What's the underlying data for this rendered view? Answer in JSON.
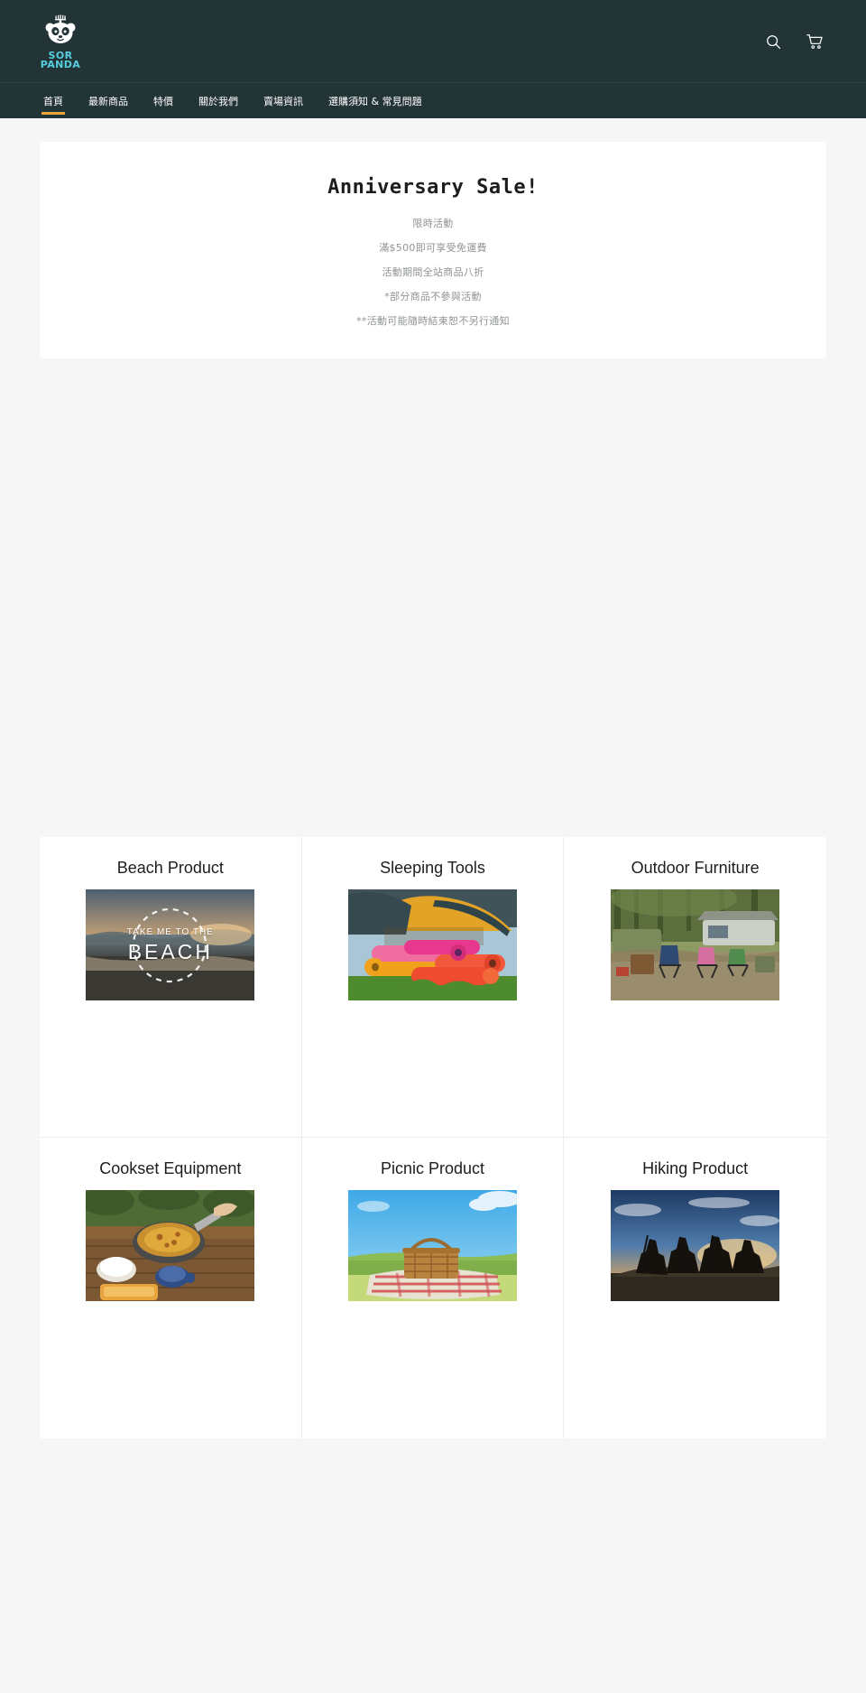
{
  "header": {
    "logo": {
      "line1": "SOR",
      "line2": "PANDA",
      "icon": "panda-logo-icon",
      "color": "#55cfe0"
    },
    "search_icon": "search-icon",
    "cart_icon": "shopping-cart-icon",
    "background": "#233437"
  },
  "nav": {
    "active_color": "#e8a33d",
    "items": [
      {
        "label": "首頁",
        "active": true
      },
      {
        "label": "最新商品",
        "active": false
      },
      {
        "label": "特價",
        "active": false
      },
      {
        "label": "關於我們",
        "active": false
      },
      {
        "label": "賣場資訊",
        "active": false
      },
      {
        "label": "選購須知 & 常見問題",
        "active": false
      }
    ]
  },
  "announcement": {
    "title": "Anniversary Sale!",
    "lines": [
      "限時活動",
      "滿$500即可享受免運費",
      "活動期間全站商品八折",
      "*部分商品不參與活動",
      "**活動可能隨時結束恕不另行通知"
    ]
  },
  "collections": [
    {
      "title": "Beach Product",
      "image": "beach-photo",
      "overlay_top": "TAKE ME TO THE",
      "overlay_bottom": "BEACH"
    },
    {
      "title": "Sleeping Tools",
      "image": "sleeping-mats-photo",
      "overlay_top": "",
      "overlay_bottom": ""
    },
    {
      "title": "Outdoor Furniture",
      "image": "campsite-chairs-photo",
      "overlay_top": "",
      "overlay_bottom": ""
    },
    {
      "title": "Cookset Equipment",
      "image": "camp-cooking-photo",
      "overlay_top": "",
      "overlay_bottom": ""
    },
    {
      "title": "Picnic Product",
      "image": "picnic-basket-photo",
      "overlay_top": "",
      "overlay_bottom": ""
    },
    {
      "title": "Hiking Product",
      "image": "hikers-sunset-photo",
      "overlay_top": "",
      "overlay_bottom": ""
    }
  ]
}
